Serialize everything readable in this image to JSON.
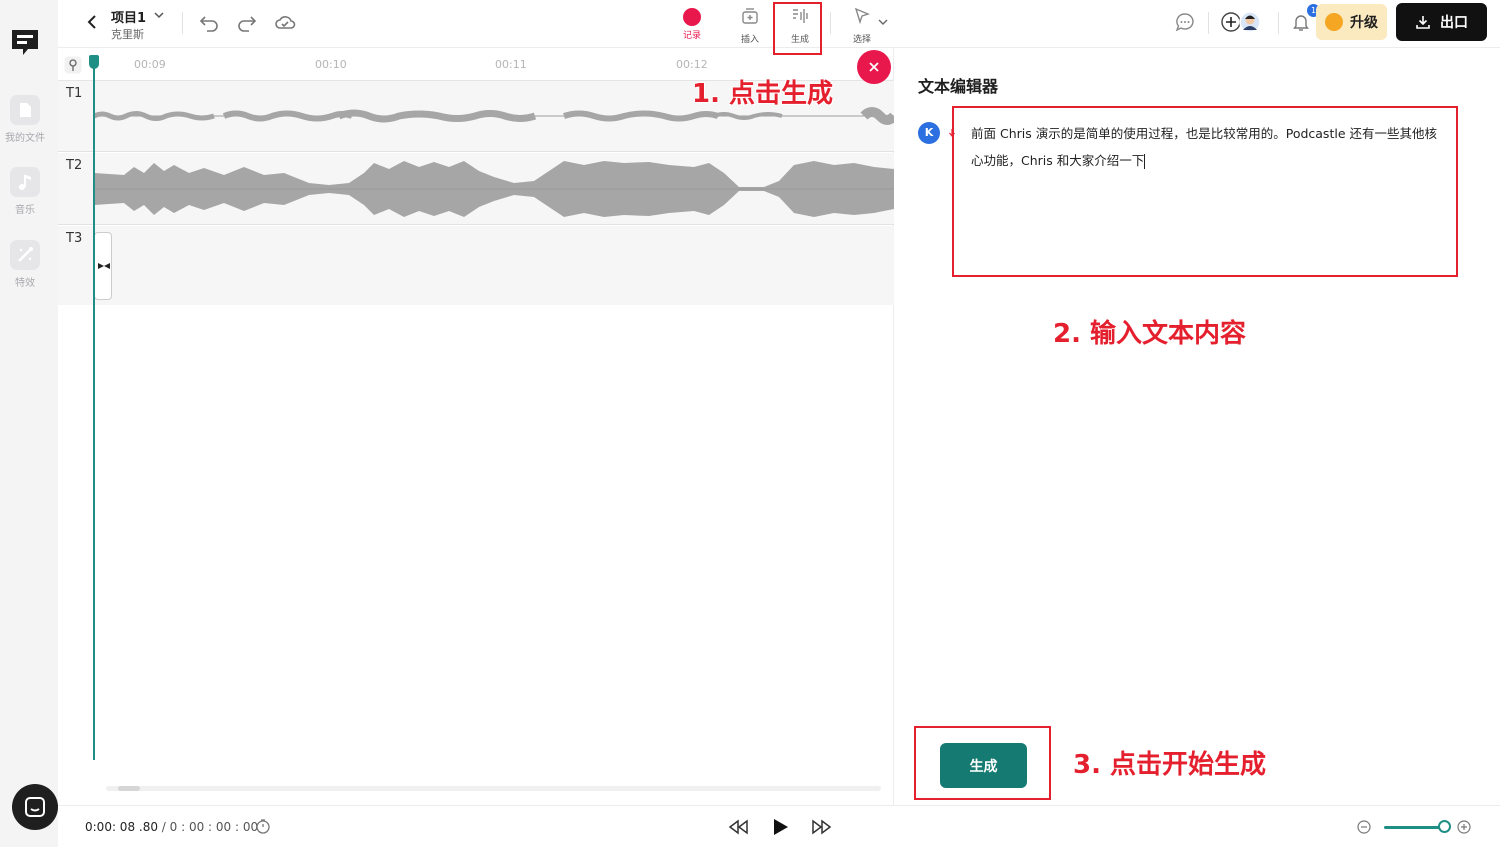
{
  "app": {
    "project_name": "项目1",
    "project_owner": "克里斯"
  },
  "toolbar": {
    "tools": [
      {
        "label": "记录"
      },
      {
        "label": "插入"
      },
      {
        "label": "生成"
      },
      {
        "label": "选择"
      }
    ],
    "notification_count": "1",
    "upgrade_label": "升级",
    "export_label": "出口"
  },
  "sidebar": {
    "items": [
      {
        "label": "我的文件"
      },
      {
        "label": "音乐"
      },
      {
        "label": "特效"
      }
    ]
  },
  "timeline": {
    "ruler_ticks": [
      "00:09",
      "00:10",
      "00:11",
      "00:12"
    ],
    "tracks": [
      {
        "label": "T1"
      },
      {
        "label": "T2"
      },
      {
        "label": "T3"
      }
    ]
  },
  "editor": {
    "title": "文本编辑器",
    "speaker_initial": "K",
    "text_line1": "前面 Chris 演示的是简单的使用过程，也是比较常用的。Podcastle 还有一些其他核",
    "text_line2": "心功能，Chris 和大家介绍一下",
    "generate_label": "生成"
  },
  "annotations": {
    "step1": "1. 点击生成",
    "step2": "2. 输入文本内容",
    "step3": "3. 点击开始生成",
    "color": "#e5202e"
  },
  "playback": {
    "current_time": "0:00: 08 .80",
    "total_time": "0 : 00 : 00 : 00",
    "zoom_level": 1.0
  },
  "colors": {
    "accent": "#157a72",
    "record": "#e8174c",
    "playhead": "#1f8e85",
    "waveform": "#a6a6a6"
  }
}
